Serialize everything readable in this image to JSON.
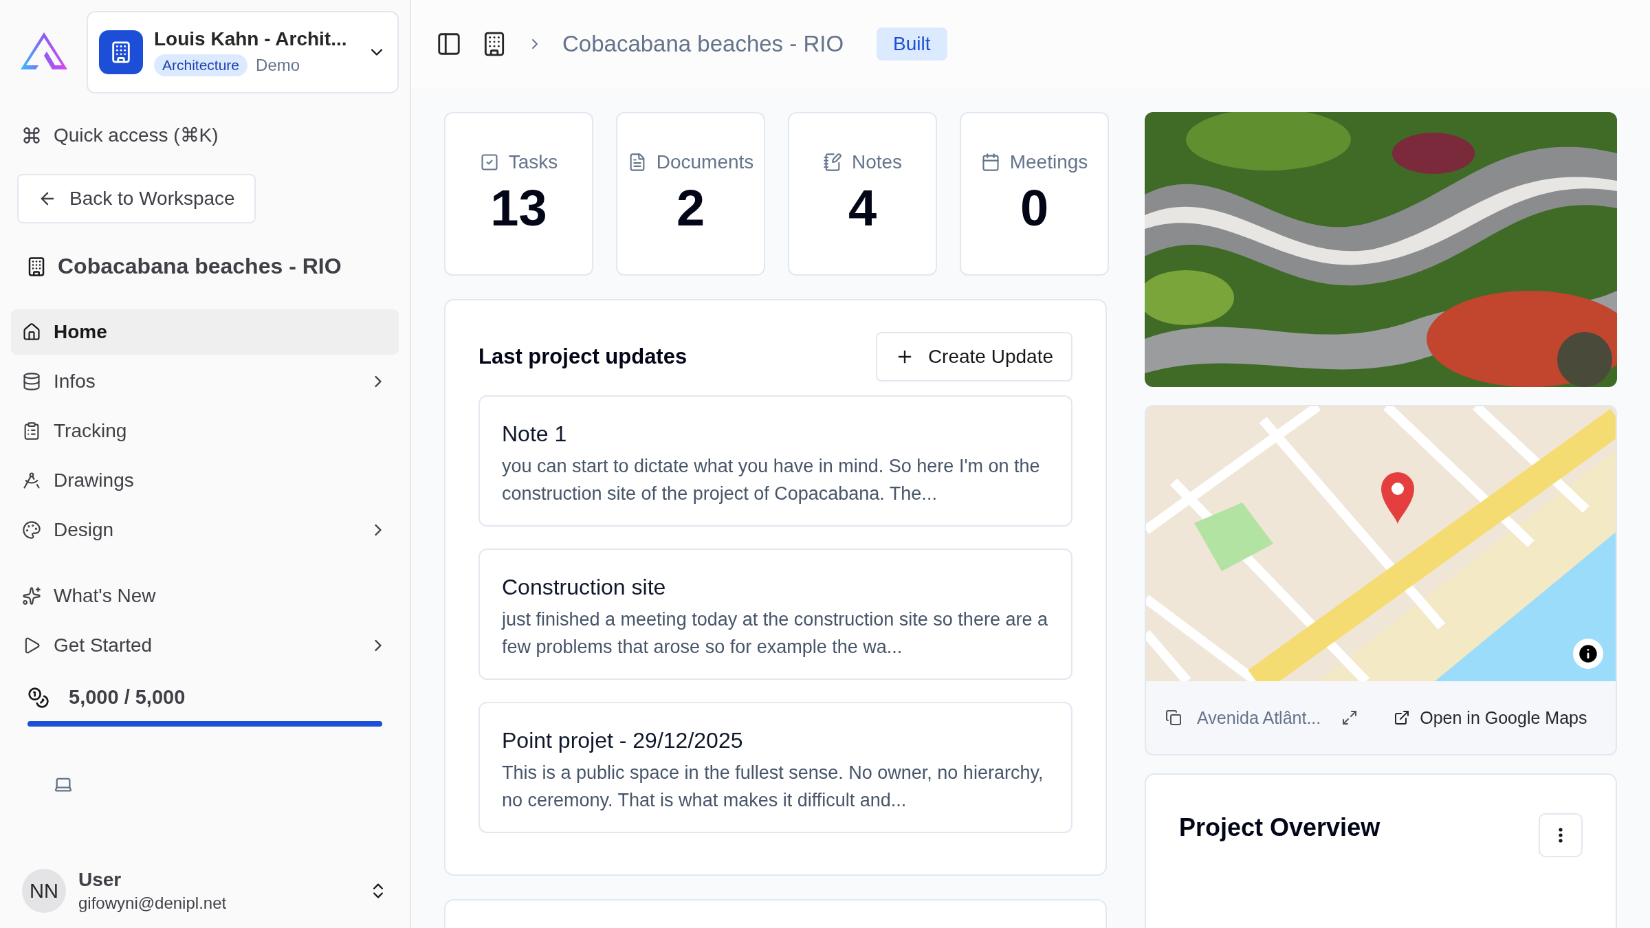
{
  "workspace": {
    "name": "Louis Kahn - Archit...",
    "tag": "Architecture",
    "plan": "Demo"
  },
  "quick_access": "Quick access (⌘K)",
  "back_button": "Back to Workspace",
  "project_title": "Cobacabana beaches - RIO",
  "nav": [
    {
      "kind": "home",
      "label": "Home",
      "selected": true,
      "expandable": false
    },
    {
      "kind": "database",
      "label": "Infos",
      "selected": false,
      "expandable": true
    },
    {
      "kind": "clipboard",
      "label": "Tracking",
      "selected": false,
      "expandable": false
    },
    {
      "kind": "compass",
      "label": "Drawings",
      "selected": false,
      "expandable": false
    },
    {
      "kind": "palette",
      "label": "Design",
      "selected": false,
      "expandable": true
    }
  ],
  "nav_secondary": [
    {
      "kind": "sparkles",
      "label": "What's New",
      "selected": false,
      "expandable": false
    },
    {
      "kind": "play",
      "label": "Get Started",
      "selected": false,
      "expandable": true
    }
  ],
  "credits": {
    "text": "5,000 / 5,000",
    "level": 1
  },
  "user": {
    "initials": "NN",
    "name": "User",
    "email": "gifowyni@denipl.net"
  },
  "breadcrumb": {
    "title": "Cobacabana beaches - RIO",
    "status": "Built"
  },
  "stats": [
    {
      "kind": "tasks",
      "label": "Tasks",
      "value": "13"
    },
    {
      "kind": "documents",
      "label": "Documents",
      "value": "2"
    },
    {
      "kind": "notes",
      "label": "Notes",
      "value": "4"
    },
    {
      "kind": "meetings",
      "label": "Meetings",
      "value": "0"
    }
  ],
  "updates": {
    "title": "Last project updates",
    "create_button": "Create Update",
    "items": [
      {
        "title": "Note 1",
        "body": "you can start to dictate what you have in mind. So here I'm on the construction site of the project of Copacabana. The..."
      },
      {
        "title": "Construction site",
        "body": "just finished a meeting today at the construction site so there are a few problems that arose so for example the wa..."
      },
      {
        "title": "Point projet - 29/12/2025",
        "body": "This is a public space in the fullest sense. No owner, no hierarchy, no ceremony. That is what makes it difficult and..."
      }
    ]
  },
  "map": {
    "address": "Avenida Atlânt...",
    "open_link": "Open in Google Maps"
  },
  "overview": {
    "title": "Project Overview"
  }
}
